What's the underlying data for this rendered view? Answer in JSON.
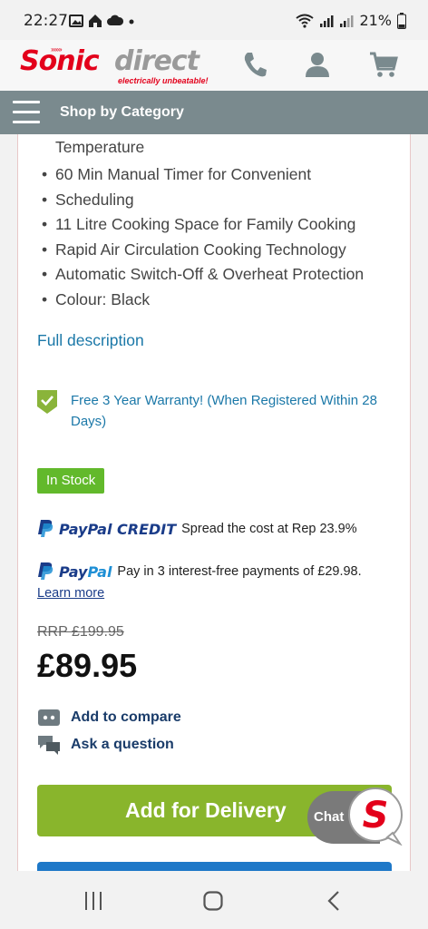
{
  "status_bar": {
    "time": "22:27",
    "battery": "21%",
    "icons_left": [
      "image-icon",
      "home-icon",
      "cloud-icon",
      "dot-icon"
    ],
    "icons_right": [
      "wifi-icon",
      "signal-icon",
      "signal-icon",
      "battery-icon"
    ]
  },
  "header": {
    "logo_brand_part1": "Sonic",
    "logo_brand_part2": "direct",
    "logo_tagline": "electrically unbeatable!",
    "icons": [
      "phone-icon",
      "account-icon",
      "cart-icon"
    ]
  },
  "category_bar": {
    "label": "Shop by Category"
  },
  "features": {
    "continuation": "Temperature",
    "items": [
      "60 Min Manual Timer for Convenient",
      "Scheduling",
      "11 Litre Cooking Space for Family Cooking",
      "Rapid Air Circulation Cooking Technology",
      "Automatic Switch-Off & Overheat Protection",
      "Colour: Black"
    ]
  },
  "full_description_link": "Full description",
  "warranty": {
    "text": "Free 3 Year Warranty! (When Registered Within 28 Days)"
  },
  "stock_status": "In Stock",
  "paypal_credit": {
    "logo_part1": "PayPal",
    "logo_part2": "CREDIT",
    "text": "Spread the cost at Rep 23.9%"
  },
  "paypal_pay_in_3": {
    "logo_part1": "Pay",
    "logo_part2": "Pal",
    "text": "Pay in 3 interest-free payments of £29.98.",
    "learn_more": "Learn more"
  },
  "pricing": {
    "rrp": "RRP £199.95",
    "price": "£89.95"
  },
  "actions": {
    "compare": "Add to compare",
    "question": "Ask a question"
  },
  "buttons": {
    "add_for_delivery": "Add for Delivery"
  },
  "chat": {
    "label": "Chat",
    "brand_letter": "S"
  },
  "colors": {
    "brand_red": "#e3001b",
    "category_bar": "#7a8a8e",
    "link_blue": "#1b78a8",
    "stock_green": "#62b92b",
    "delivery_green": "#89b52c",
    "paypal_dark": "#1a3c89",
    "paypal_light": "#1e8fd5"
  }
}
